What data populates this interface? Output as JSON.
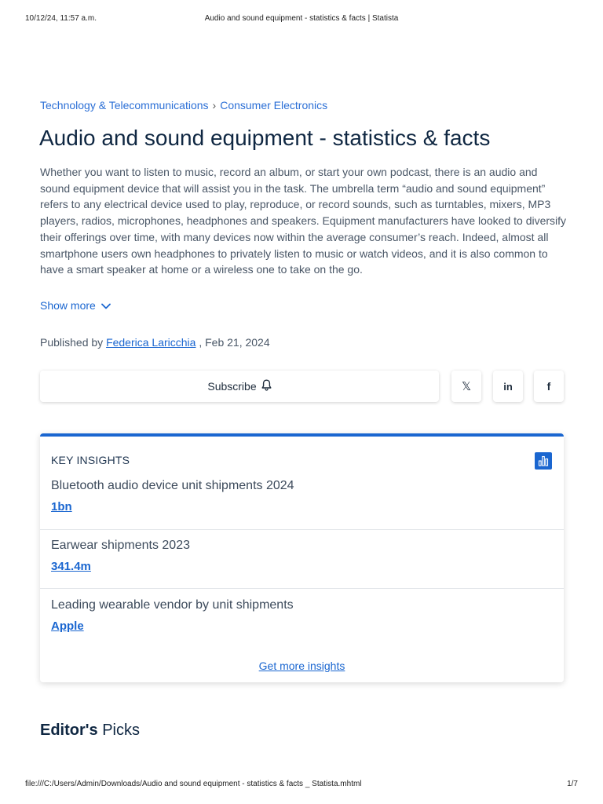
{
  "print_header": {
    "timestamp": "10/12/24, 11:57 a.m.",
    "page_title": "Audio and sound equipment - statistics & facts | Statista"
  },
  "breadcrumb": {
    "items": [
      "Technology & Telecommunications",
      "Consumer Electronics"
    ],
    "separator": "›"
  },
  "title": "Audio and sound equipment - statistics & facts",
  "description": "Whether you want to listen to music, record an album, or start your own podcast, there is an audio and sound equipment device that will assist you in the task. The umbrella term “audio and sound equipment” refers to any electrical device used to play, reproduce, or record sounds, such as turntables, mixers, MP3 players, radios, microphones, headphones and speakers. Equipment manufacturers have looked to diversify their offerings over time, with many devices now within the average consumer’s reach. Indeed, almost all smartphone users own headphones to privately listen to music or watch videos, and it is also common to have a smart speaker at home or a wireless one to take on the go.",
  "show_more_label": "Show more",
  "published": {
    "prefix": "Published by",
    "author": "Federica Laricchia",
    "date": ", Feb 21, 2024"
  },
  "share": {
    "subscribe_label": "Subscribe",
    "x_label": "𝕏",
    "linkedin_label": "in",
    "facebook_label": "f"
  },
  "key_insights": {
    "heading": "KEY INSIGHTS",
    "items": [
      {
        "label": "Bluetooth audio device unit shipments 2024",
        "value": "1bn"
      },
      {
        "label": "Earwear shipments 2023",
        "value": "341.4m"
      },
      {
        "label": "Leading wearable vendor by unit shipments",
        "value": "Apple"
      }
    ],
    "more_label": "Get more insights"
  },
  "editors_picks": {
    "bold": "Editor's",
    "rest": " Picks"
  },
  "print_footer": {
    "file_path": "file:///C:/Users/Admin/Downloads/Audio and sound equipment - statistics & facts _ Statista.mhtml",
    "page": "1/7"
  },
  "colors": {
    "accent": "#1a66d0",
    "title": "#0f2742",
    "body_text": "#4a5767"
  }
}
